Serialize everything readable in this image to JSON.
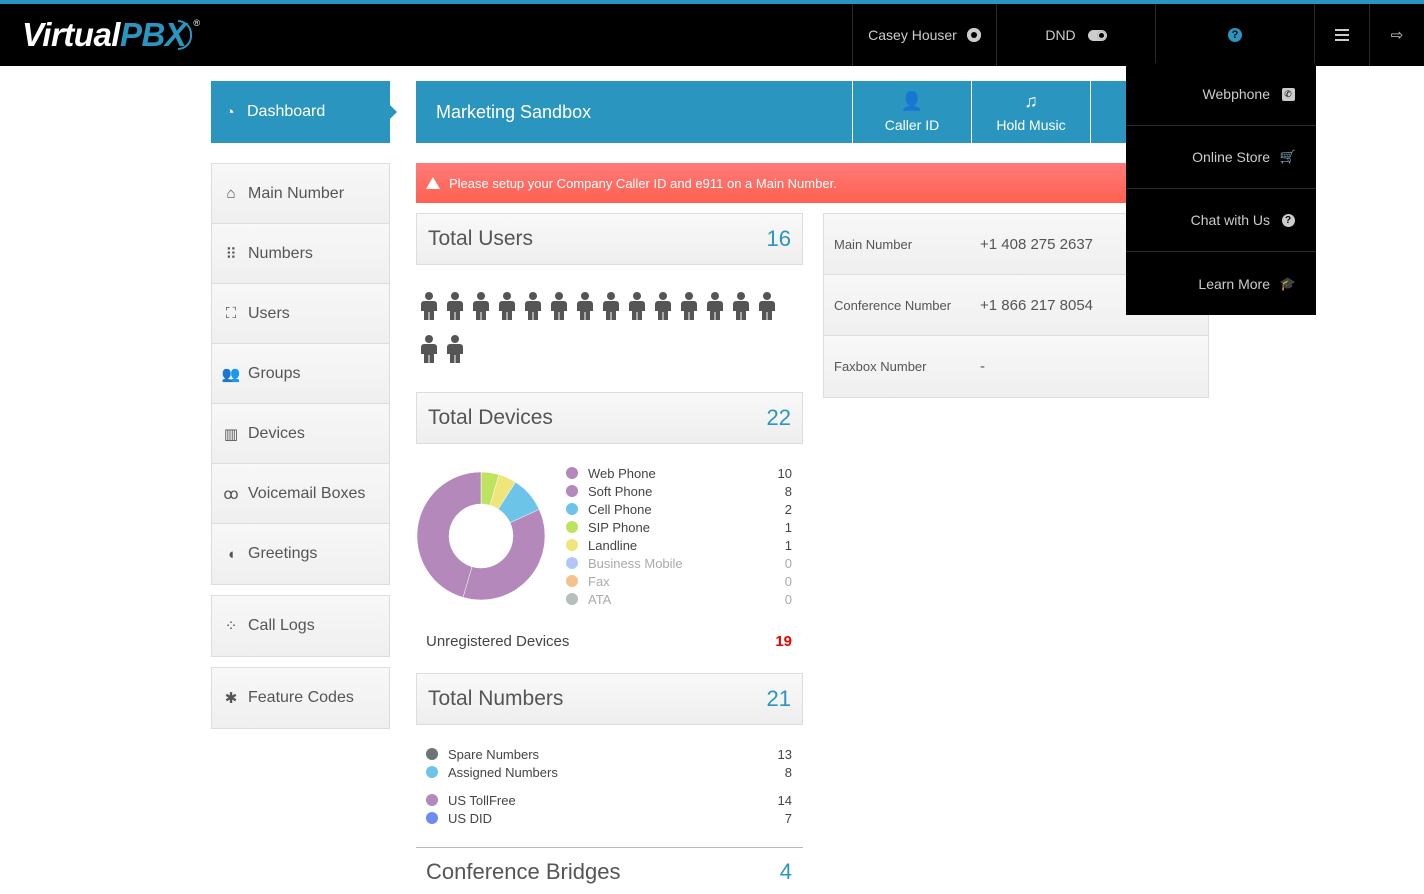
{
  "brand": {
    "name_part1": "Virtual",
    "name_part2": "PBX",
    "registered": "®",
    "accent": "#2a96c0"
  },
  "topnav": {
    "user_name": "Casey Houser",
    "dnd_label": "DND",
    "dnd_enabled": false,
    "icons": {
      "settings": "gear-icon",
      "dnd": "toggle-icon",
      "help": "question-circle-icon",
      "menu": "hamburger-icon",
      "logout": "sign-out-icon"
    }
  },
  "dropdown": {
    "items": [
      {
        "label": "Webphone",
        "icon": "phone-square-icon"
      },
      {
        "label": "Online Store",
        "icon": "shopping-cart-icon"
      },
      {
        "label": "Chat with Us",
        "icon": "question-circle-icon"
      },
      {
        "label": "Learn More",
        "icon": "graduation-cap-icon"
      }
    ]
  },
  "sidebar": {
    "active": {
      "label": "Dashboard",
      "icon": "dashboard-icon"
    },
    "groups": [
      [
        {
          "label": "Main Number",
          "icon": "home-icon"
        },
        {
          "label": "Numbers",
          "icon": "grid-icon"
        },
        {
          "label": "Users",
          "icon": "users-icon"
        },
        {
          "label": "Groups",
          "icon": "group-icon"
        },
        {
          "label": "Devices",
          "icon": "fax-device-icon"
        },
        {
          "label": "Voicemail Boxes",
          "icon": "voicemail-icon"
        },
        {
          "label": "Greetings",
          "icon": "speaking-head-icon"
        }
      ],
      [
        {
          "label": "Call Logs",
          "icon": "call-logs-icon"
        }
      ],
      [
        {
          "label": "Feature Codes",
          "icon": "asterisk-icon"
        }
      ]
    ]
  },
  "banner": {
    "title": "Marketing Sandbox",
    "buttons": [
      {
        "label": "Caller ID",
        "icon": "user-icon"
      },
      {
        "label": "Hold Music",
        "icon": "music-icon"
      }
    ]
  },
  "alert": {
    "message": "Please setup your Company Caller ID and e911 on a Main Number.",
    "icon": "warning-icon",
    "color": "#ff6c64"
  },
  "stats": {
    "users": {
      "title": "Total Users",
      "value": "16",
      "count": 16
    },
    "devices": {
      "title": "Total Devices",
      "value": "22",
      "unregistered_label": "Unregistered Devices",
      "unregistered_value": "19"
    },
    "numbers": {
      "title": "Total Numbers",
      "value": "21",
      "group1": [
        {
          "label": "Spare Numbers",
          "value": "13",
          "color": "#6b7476"
        },
        {
          "label": "Assigned Numbers",
          "value": "8",
          "color": "#6cc4e8"
        }
      ],
      "group2": [
        {
          "label": "US TollFree",
          "value": "14",
          "color": "#b488bb"
        },
        {
          "label": "US DID",
          "value": "7",
          "color": "#6c8cf0"
        }
      ]
    },
    "conference": {
      "title": "Conference Bridges",
      "value": "4"
    }
  },
  "info": [
    {
      "label": "Main Number",
      "value": "+1 408 275 2637"
    },
    {
      "label": "Conference Number",
      "value": "+1 866 217 8054"
    },
    {
      "label": "Faxbox Number",
      "value": "-"
    }
  ],
  "chart_data": {
    "type": "pie",
    "title": "Total Devices",
    "donut": true,
    "categories": [
      "Web Phone",
      "Soft Phone",
      "Cell Phone",
      "SIP Phone",
      "Landline",
      "Business Mobile",
      "Fax",
      "ATA"
    ],
    "values": [
      10,
      8,
      2,
      1,
      1,
      0,
      0,
      0
    ],
    "colors": [
      "#b488bb",
      "#b488bb",
      "#6cc4e8",
      "#bde35f",
      "#efe57a",
      "#b3c6f7",
      "#f5c28f",
      "#b7bfbd"
    ],
    "draw_order_clockwise_from_top": [
      "SIP Phone",
      "Landline",
      "Cell Phone",
      "Soft Phone",
      "Web Phone"
    ],
    "legend": "right"
  }
}
